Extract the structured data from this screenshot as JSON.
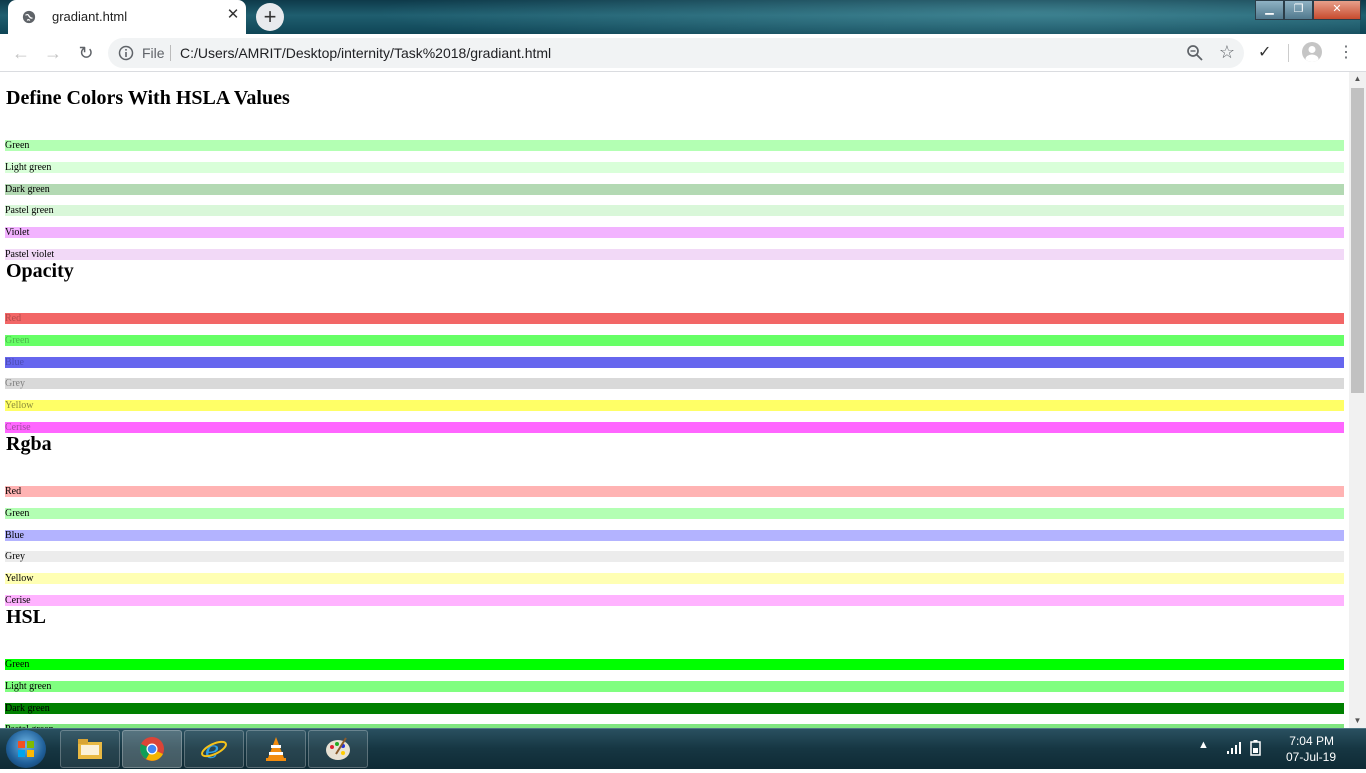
{
  "browser": {
    "tab_title": "gradiant.html",
    "close_glyph": "✕",
    "new_tab_glyph": "+",
    "file_label": "File",
    "url": "C:/Users/AMRIT/Desktop/internity/Task%2018/gradiant.html",
    "back_glyph": "←",
    "forward_glyph": "→",
    "reload_glyph": "↻",
    "star_glyph": "☆",
    "check_glyph": "✓",
    "menu_glyph": "⋮",
    "window_buttons": {
      "minimize": "▁",
      "maximize": "❐",
      "close": "✕"
    }
  },
  "page": {
    "sections": [
      {
        "heading": "Define Colors With HSLA Values",
        "rows": [
          {
            "label": "Green",
            "bg": "#b3ffb3",
            "fg": "#000000"
          },
          {
            "label": "Light green",
            "bg": "#d9ffd9",
            "fg": "#000000"
          },
          {
            "label": "Dark green",
            "bg": "#b3d9b3",
            "fg": "#000000"
          },
          {
            "label": "Pastel green",
            "bg": "#d9f7d9",
            "fg": "#000000"
          },
          {
            "label": "Violet",
            "bg": "#f2b3ff",
            "fg": "#000000"
          },
          {
            "label": "Pastel violet",
            "bg": "#f2d9f7",
            "fg": "#000000"
          }
        ]
      },
      {
        "heading": "Opacity",
        "rows": [
          {
            "label": "Red",
            "bg": "#f26666",
            "fg": "#b44c4c"
          },
          {
            "label": "Green",
            "bg": "#66ff66",
            "fg": "#4cb44c"
          },
          {
            "label": "Blue",
            "bg": "#6666ee",
            "fg": "#4c4cb4"
          },
          {
            "label": "Grey",
            "bg": "#d9d9d9",
            "fg": "#7f7f7f"
          },
          {
            "label": "Yellow",
            "bg": "#ffff66",
            "fg": "#8c8c3a"
          },
          {
            "label": "Cerise",
            "bg": "#ff66ff",
            "fg": "#a04ca0"
          }
        ]
      },
      {
        "heading": "Rgba",
        "rows": [
          {
            "label": "Red",
            "bg": "#ffb3b3",
            "fg": "#000000"
          },
          {
            "label": "Green",
            "bg": "#b3ffb3",
            "fg": "#000000"
          },
          {
            "label": "Blue",
            "bg": "#b3b3ff",
            "fg": "#000000"
          },
          {
            "label": "Grey",
            "bg": "#ececec",
            "fg": "#000000"
          },
          {
            "label": "Yellow",
            "bg": "#ffffb3",
            "fg": "#000000"
          },
          {
            "label": "Cerise",
            "bg": "#ffb3ff",
            "fg": "#000000"
          }
        ]
      },
      {
        "heading": "HSL",
        "rows": [
          {
            "label": "Green",
            "bg": "#00ff00",
            "fg": "#000000"
          },
          {
            "label": "Light green",
            "bg": "#80ff80",
            "fg": "#000000"
          },
          {
            "label": "Dark green",
            "bg": "#008000",
            "fg": "#000000"
          },
          {
            "label": "Pastel green",
            "bg": "#80e680",
            "fg": "#000000"
          }
        ]
      }
    ]
  },
  "taskbar": {
    "apps": [
      "file-explorer",
      "chrome",
      "internet-explorer",
      "vlc",
      "paint"
    ],
    "active_app": "chrome",
    "time": "7:04 PM",
    "date": "07-Jul-19",
    "tray_glyph": "▲"
  }
}
